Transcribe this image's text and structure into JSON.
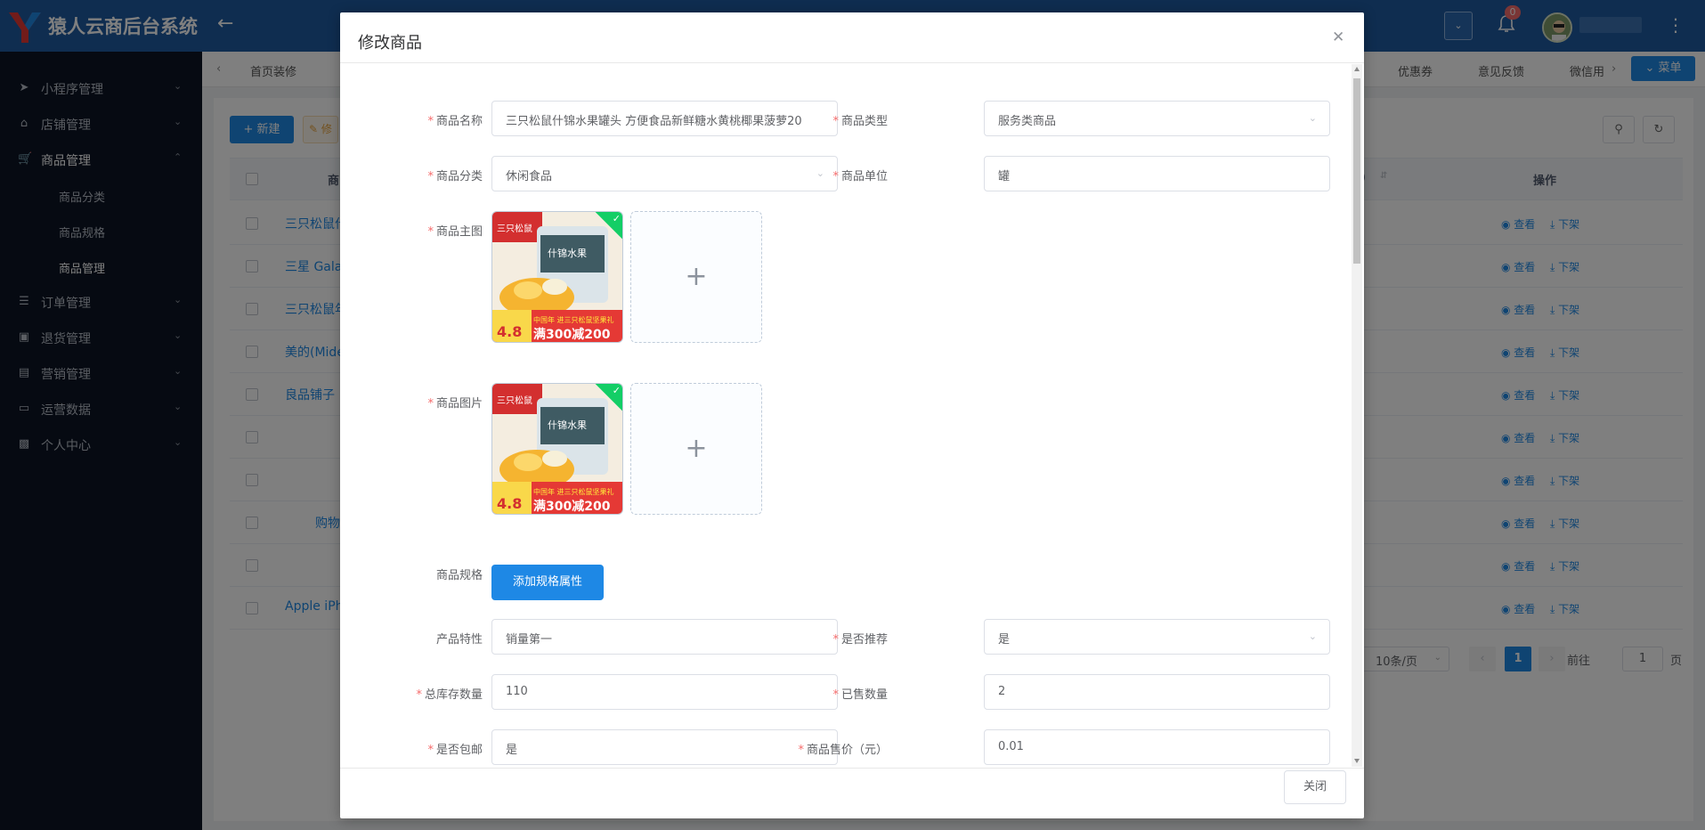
{
  "header": {
    "app_title": "猿人云商后台系统",
    "back_icon": "arrow-left-icon",
    "notification_count": "0",
    "more_icon": "more-vertical-icon"
  },
  "sidebar": {
    "items": [
      {
        "label": "小程序管理",
        "icon": "send-icon"
      },
      {
        "label": "店铺管理",
        "icon": "home-icon"
      },
      {
        "label": "商品管理",
        "icon": "cart-icon",
        "expanded": true
      },
      {
        "label": "订单管理",
        "icon": "list-icon"
      },
      {
        "label": "退货管理",
        "icon": "lock-icon"
      },
      {
        "label": "营销管理",
        "icon": "clipboard-icon"
      },
      {
        "label": "运营数据",
        "icon": "monitor-icon"
      },
      {
        "label": "个人中心",
        "icon": "user-lock-icon"
      }
    ],
    "sub_items": [
      {
        "label": "商品分类"
      },
      {
        "label": "商品规格"
      },
      {
        "label": "商品管理",
        "active": true
      }
    ]
  },
  "tabs": {
    "items": [
      "首页装修",
      "优惠券",
      "意见反馈",
      "微信用"
    ],
    "menu_button": "菜单"
  },
  "toolbar": {
    "new_button": "新建",
    "edit_button": "修"
  },
  "table": {
    "header_name": "商",
    "header_col": ")",
    "header_actions": "操作",
    "view_label": "查看",
    "offshelf_label": "下架",
    "rows": [
      {
        "name": "三只松鼠什"
      },
      {
        "name": "三星 Gala"
      },
      {
        "name": "三只松鼠年"
      },
      {
        "name": "美的(Mide"
      },
      {
        "name": "良品铺子"
      },
      {
        "name": ""
      },
      {
        "name": ""
      },
      {
        "name": "购物"
      },
      {
        "name": ""
      },
      {
        "name": "Apple iPh"
      }
    ]
  },
  "pagination": {
    "page_size": "10条/页",
    "current_page": "1",
    "goto_label": "前往",
    "goto_value": "1",
    "page_suffix": "页"
  },
  "dialog": {
    "title": "修改商品",
    "close_icon": "close-icon",
    "fields": {
      "name_label": "商品名称",
      "name_value": "三只松鼠什锦水果罐头 方便食品新鲜糖水黄桃椰果菠萝20",
      "type_label": "商品类型",
      "type_value": "服务类商品",
      "category_label": "商品分类",
      "category_value": "休闲食品",
      "unit_label": "商品单位",
      "unit_value": "罐",
      "main_image_label": "商品主图",
      "images_label": "商品图片",
      "spec_label": "商品规格",
      "spec_button": "添加规格属性",
      "feature_label": "产品特性",
      "feature_value": "销量第一",
      "recommend_label": "是否推荐",
      "recommend_value": "是",
      "stock_label": "总库存数量",
      "stock_value": "110",
      "sold_label": "已售数量",
      "sold_value": "2",
      "free_ship_label": "是否包邮",
      "free_ship_value": "是",
      "price_label": "商品售价（元）",
      "price_value": "0.01"
    },
    "product_image_text": {
      "brand": "三只松鼠",
      "product": "什锦水果",
      "rating": "4.8",
      "promo": "满300减200",
      "banner": "中国年 进三只松鼠坚果礼"
    },
    "footer_close": "关闭"
  },
  "colors": {
    "header_bg": "#1e5aa0",
    "sidebar_bg": "#0c1525",
    "primary": "#1e88e5",
    "required_star": "#f56c6c",
    "upload_success": "#13ce66"
  }
}
